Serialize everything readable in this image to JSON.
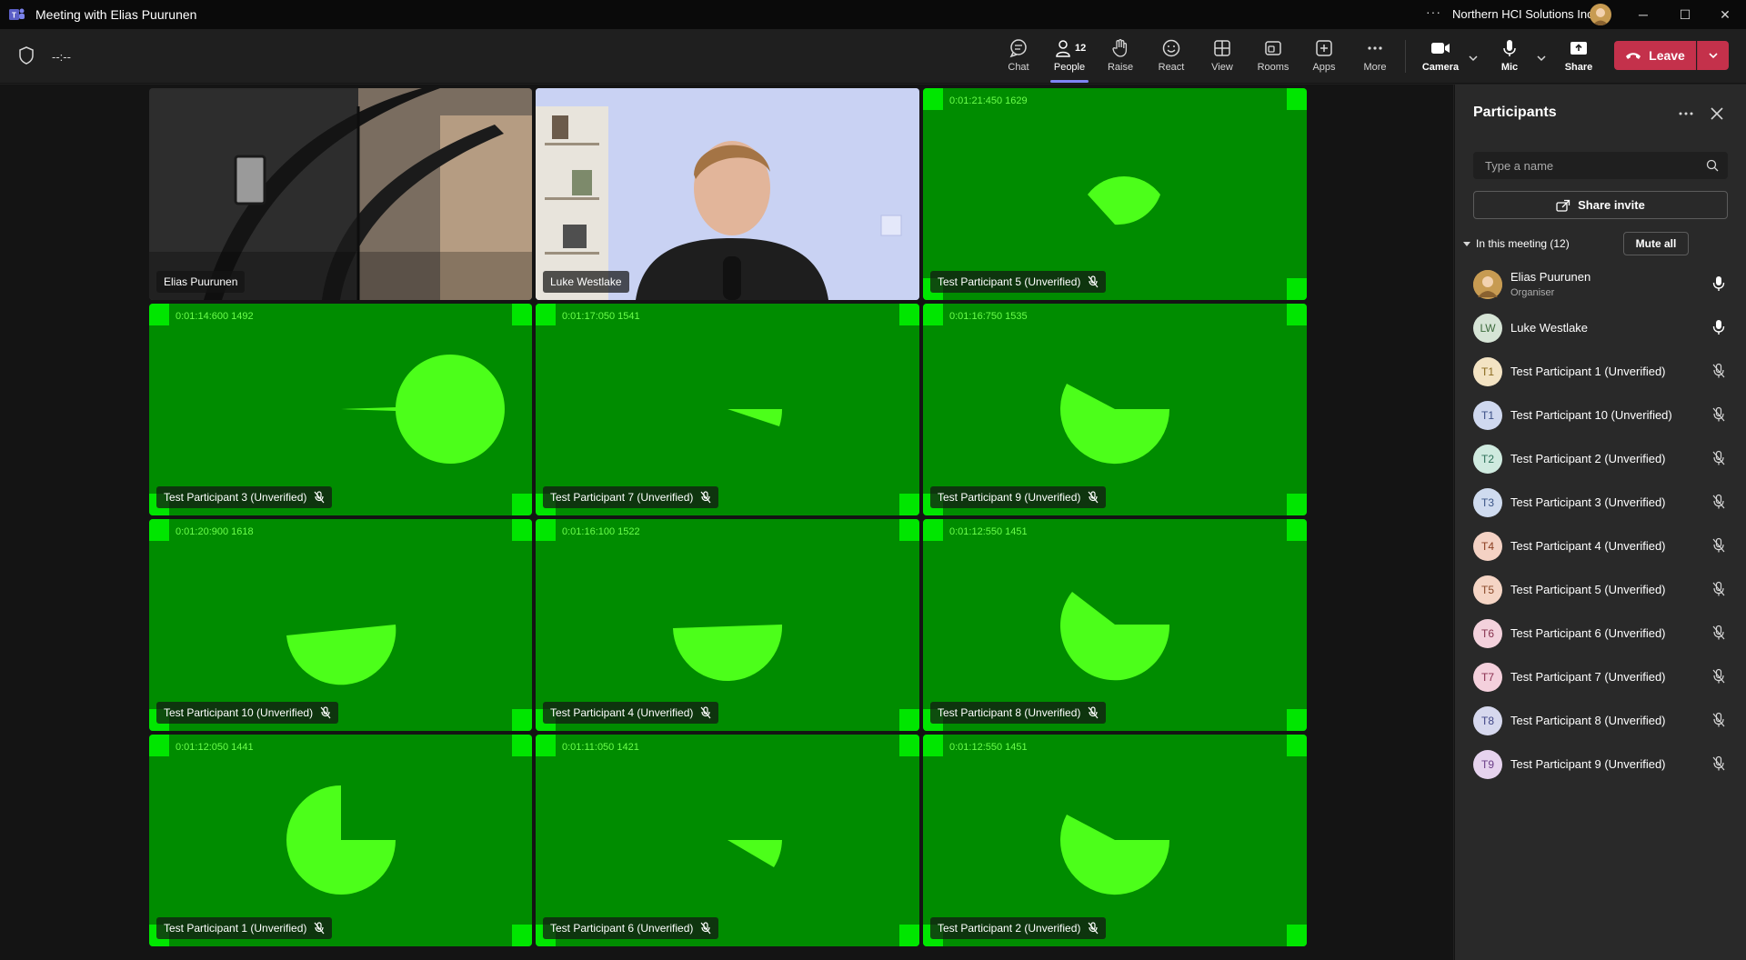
{
  "window": {
    "title": "Meeting with Elias Puurunen",
    "more": "···",
    "org": "Northern HCI Solutions Inc",
    "minimize": "─",
    "maximize": "☐",
    "close": "✕"
  },
  "toolbar": {
    "timer": "--:--",
    "chat": "Chat",
    "people": "People",
    "people_count": "12",
    "raise": "Raise",
    "react": "React",
    "view": "View",
    "rooms": "Rooms",
    "apps": "Apps",
    "more": "More",
    "camera": "Camera",
    "mic": "Mic",
    "share": "Share",
    "leave": "Leave"
  },
  "tiles": [
    {
      "name": "Elias Puurunen",
      "timestamp": "",
      "shape": "video",
      "muted": false
    },
    {
      "name": "Luke Westlake",
      "timestamp": "",
      "shape": "video",
      "muted": false
    },
    {
      "name": "Test Participant 5 (Unverified)",
      "timestamp": "0:01:21:450 1629",
      "shape": "wedge-a",
      "muted": true
    },
    {
      "name": "Test Participant 3 (Unverified)",
      "timestamp": "0:01:14:600 1492",
      "shape": "full",
      "muted": true
    },
    {
      "name": "Test Participant 7 (Unverified)",
      "timestamp": "0:01:17:050 1541",
      "shape": "sliver",
      "muted": true
    },
    {
      "name": "Test Participant 9 (Unverified)",
      "timestamp": "0:01:16:750 1535",
      "shape": "half-notch",
      "muted": true
    },
    {
      "name": "Test Participant 10 (Unverified)",
      "timestamp": "0:01:20:900 1618",
      "shape": "half-low",
      "muted": true
    },
    {
      "name": "Test Participant 4 (Unverified)",
      "timestamp": "0:01:16:100 1522",
      "shape": "half-low2",
      "muted": true
    },
    {
      "name": "Test Participant 8 (Unverified)",
      "timestamp": "0:01:12:550 1451",
      "shape": "half-notch",
      "muted": true
    },
    {
      "name": "Test Participant 1 (Unverified)",
      "timestamp": "0:01:12:050 1441",
      "shape": "three-quarter",
      "muted": true
    },
    {
      "name": "Test Participant 6 (Unverified)",
      "timestamp": "0:01:11:050 1421",
      "shape": "sliver2",
      "muted": true
    },
    {
      "name": "Test Participant 2 (Unverified)",
      "timestamp": "0:01:12:550 1451",
      "shape": "half-notch",
      "muted": true
    }
  ],
  "panel": {
    "title": "Participants",
    "search_placeholder": "Type a name",
    "share_invite": "Share invite",
    "section_label": "In this meeting (12)",
    "mute_all": "Mute all",
    "participants": [
      {
        "initials": "",
        "name": "Elias Puurunen",
        "role": "Organiser",
        "muted": false,
        "avatar_bg": "#c79b52",
        "avatar_fg": "#ffffff"
      },
      {
        "initials": "LW",
        "name": "Luke Westlake",
        "role": "",
        "muted": false,
        "avatar_bg": "#d6e4d6",
        "avatar_fg": "#3d6b3d"
      },
      {
        "initials": "T1",
        "name": "Test Participant 1 (Unverified)",
        "role": "",
        "muted": true,
        "avatar_bg": "#f3e3c3",
        "avatar_fg": "#8a6a1f"
      },
      {
        "initials": "T1",
        "name": "Test Participant 10 (Unverified)",
        "role": "",
        "muted": true,
        "avatar_bg": "#cfd8ef",
        "avatar_fg": "#3b4f86"
      },
      {
        "initials": "T2",
        "name": "Test Participant 2 (Unverified)",
        "role": "",
        "muted": true,
        "avatar_bg": "#cfeadf",
        "avatar_fg": "#2d7058"
      },
      {
        "initials": "T3",
        "name": "Test Participant 3 (Unverified)",
        "role": "",
        "muted": true,
        "avatar_bg": "#cfdbef",
        "avatar_fg": "#3b5586"
      },
      {
        "initials": "T4",
        "name": "Test Participant 4 (Unverified)",
        "role": "",
        "muted": true,
        "avatar_bg": "#f4d2c4",
        "avatar_fg": "#8a3d1f"
      },
      {
        "initials": "T5",
        "name": "Test Participant 5 (Unverified)",
        "role": "",
        "muted": true,
        "avatar_bg": "#f5d5c5",
        "avatar_fg": "#8a4a2a"
      },
      {
        "initials": "T6",
        "name": "Test Participant 6 (Unverified)",
        "role": "",
        "muted": true,
        "avatar_bg": "#f3d1dc",
        "avatar_fg": "#86324e"
      },
      {
        "initials": "T7",
        "name": "Test Participant 7 (Unverified)",
        "role": "",
        "muted": true,
        "avatar_bg": "#f4d0dc",
        "avatar_fg": "#8a2f50"
      },
      {
        "initials": "T8",
        "name": "Test Participant 8 (Unverified)",
        "role": "",
        "muted": true,
        "avatar_bg": "#d6d8ee",
        "avatar_fg": "#404686"
      },
      {
        "initials": "T9",
        "name": "Test Participant 9 (Unverified)",
        "role": "",
        "muted": true,
        "avatar_bg": "#e6d3ee",
        "avatar_fg": "#6a3d86"
      }
    ]
  },
  "colors": {
    "accent": "#7f85f5",
    "leave": "#c4314b",
    "tile_green": "#008c00",
    "shape_green": "#4cff1a"
  }
}
